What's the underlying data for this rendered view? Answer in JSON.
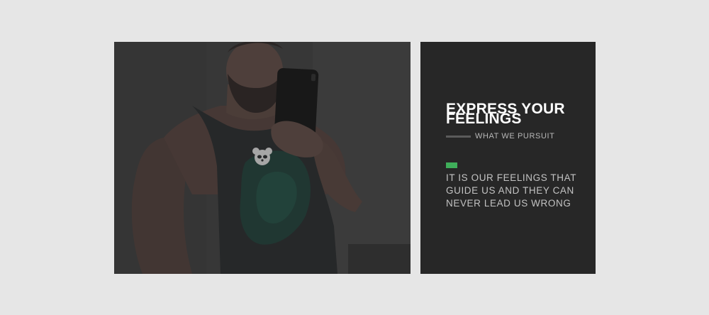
{
  "hero": {
    "image_alt": "Man taking mirror selfie in dark tank top with panda logo",
    "tank_logo_icon": "panda-icon"
  },
  "feature": {
    "title": "EXPRESS YOUR FEELINGS",
    "subtitle": "WHAT WE PURSUIT",
    "body": "IT IS OUR FEELINGS THAT GUIDE US AND THEY CAN NEVER LEAD US WRONG"
  },
  "colors": {
    "page_background": "#e6e6e6",
    "panel_background": "#272727",
    "photo_overlay": "#3b3b3b",
    "accent": "#3fae5a",
    "subtitle_line": "#5b5b5b"
  }
}
